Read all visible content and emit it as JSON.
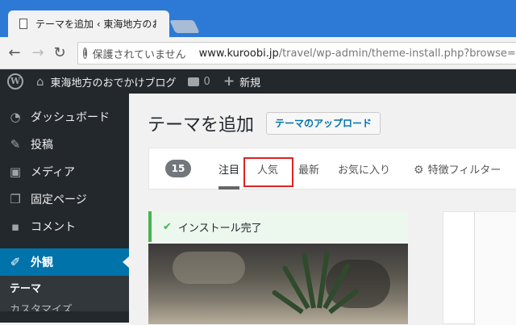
{
  "browser": {
    "tab_title": "テーマを追加 ‹ 東海地方のお",
    "security_label": "保護されていません",
    "url_host": "www.kuroobi.jp",
    "url_path": "/travel/wp-admin/theme-install.php?browse=fea"
  },
  "adminbar": {
    "site_name": "東海地方のおでかけブログ",
    "comment_count": "0",
    "new_label": "新規"
  },
  "sidebar": {
    "items": [
      {
        "label": "ダッシュボード",
        "icon": "dashboard-icon"
      },
      {
        "label": "投稿",
        "icon": "pin-icon"
      },
      {
        "label": "メディア",
        "icon": "media-icon"
      },
      {
        "label": "固定ページ",
        "icon": "page-icon"
      },
      {
        "label": "コメント",
        "icon": "comment-icon"
      },
      {
        "label": "外観",
        "icon": "brush-icon"
      }
    ],
    "submenu": [
      "テーマ",
      "カスタマイズ"
    ]
  },
  "main": {
    "title": "テーマを追加",
    "upload_button": "テーマのアップロード",
    "theme_count": "15",
    "tabs": [
      "注目",
      "人気",
      "最新",
      "お気に入り",
      "特徴フィルター"
    ],
    "notice": "インストール完了"
  },
  "colors": {
    "accent": "#0073aa",
    "adminbar": "#23282d",
    "success": "#46b450",
    "highlight_box": "#dd2222"
  }
}
